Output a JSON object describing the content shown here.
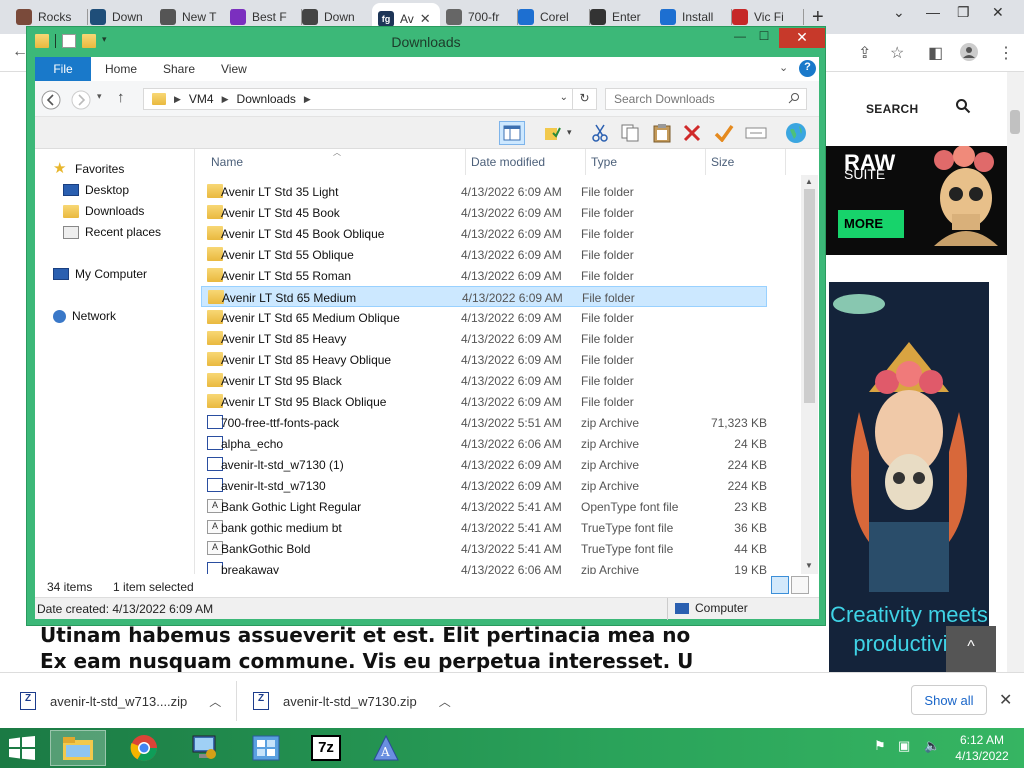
{
  "browser": {
    "tabs": [
      {
        "label": "Rocks",
        "icon": "avatar-icon",
        "color": "#7a4a3a"
      },
      {
        "label": "Down",
        "icon": "download-site-icon",
        "color": "#1f4e79"
      },
      {
        "label": "New T",
        "icon": "chrome-icon",
        "color": "#555555"
      },
      {
        "label": "Best F",
        "icon": "purple-site-icon",
        "color": "#7b2fbf"
      },
      {
        "label": "Down",
        "icon": "download-icon",
        "color": "#444444"
      },
      {
        "label": "Av",
        "icon": "fg-icon",
        "color": "#1d3557",
        "active": true
      },
      {
        "label": "700-fr",
        "icon": "globe-icon",
        "color": "#666666"
      },
      {
        "label": "Corel",
        "icon": "blue-dot-icon",
        "color": "#1d6fd1"
      },
      {
        "label": "Enter",
        "icon": "x-site-icon",
        "color": "#333333"
      },
      {
        "label": "Install",
        "icon": "blue-dot-icon",
        "color": "#1d6fd1"
      },
      {
        "label": "Vic Fi",
        "icon": "red-site-icon",
        "color": "#c62828"
      }
    ],
    "active_tab_favicon_text": "fg",
    "newtab_label": "+"
  },
  "website": {
    "search_label": "SEARCH",
    "ad1_title": "RAW",
    "ad1_subtitle": "SUITE",
    "ad1_button": "MORE",
    "ad2_text": "Creativity meets productivity",
    "lorem_line1": "Utinam habemus assueverit et est. Elit pertinacia mea no",
    "lorem_line2": "Ex eam nusquam commune. Vis eu perpetua interesset. U",
    "scrolltop_label": "^"
  },
  "downloads_bar": {
    "items": [
      {
        "label": "avenir-lt-std_w713....zip"
      },
      {
        "label": "avenir-lt-std_w7130.zip"
      }
    ],
    "show_all": "Show all"
  },
  "explorer": {
    "title": "Downloads",
    "ribbon_tabs": [
      "File",
      "Home",
      "Share",
      "View"
    ],
    "address": {
      "root": "VM4",
      "folder": "Downloads"
    },
    "search_placeholder": "Search Downloads",
    "nav": {
      "favorites": "Favorites",
      "desktop": "Desktop",
      "downloads": "Downloads",
      "recent": "Recent places",
      "computer": "My Computer",
      "network": "Network"
    },
    "columns": {
      "name": "Name",
      "date": "Date modified",
      "type": "Type",
      "size": "Size"
    },
    "files": [
      {
        "name": "Avenir LT Std 35 Light",
        "date": "4/13/2022 6:09 AM",
        "type": "File folder",
        "size": "",
        "kind": "folder"
      },
      {
        "name": "Avenir LT Std 45 Book",
        "date": "4/13/2022 6:09 AM",
        "type": "File folder",
        "size": "",
        "kind": "folder"
      },
      {
        "name": "Avenir LT Std 45 Book Oblique",
        "date": "4/13/2022 6:09 AM",
        "type": "File folder",
        "size": "",
        "kind": "folder"
      },
      {
        "name": "Avenir LT Std 55 Oblique",
        "date": "4/13/2022 6:09 AM",
        "type": "File folder",
        "size": "",
        "kind": "folder"
      },
      {
        "name": "Avenir LT Std 55 Roman",
        "date": "4/13/2022 6:09 AM",
        "type": "File folder",
        "size": "",
        "kind": "folder"
      },
      {
        "name": "Avenir LT Std 65 Medium",
        "date": "4/13/2022 6:09 AM",
        "type": "File folder",
        "size": "",
        "kind": "folder",
        "selected": true
      },
      {
        "name": "Avenir LT Std 65 Medium Oblique",
        "date": "4/13/2022 6:09 AM",
        "type": "File folder",
        "size": "",
        "kind": "folder"
      },
      {
        "name": "Avenir LT Std 85 Heavy",
        "date": "4/13/2022 6:09 AM",
        "type": "File folder",
        "size": "",
        "kind": "folder"
      },
      {
        "name": "Avenir LT Std 85 Heavy Oblique",
        "date": "4/13/2022 6:09 AM",
        "type": "File folder",
        "size": "",
        "kind": "folder"
      },
      {
        "name": "Avenir LT Std 95 Black",
        "date": "4/13/2022 6:09 AM",
        "type": "File folder",
        "size": "",
        "kind": "folder"
      },
      {
        "name": "Avenir LT Std 95 Black Oblique",
        "date": "4/13/2022 6:09 AM",
        "type": "File folder",
        "size": "",
        "kind": "folder"
      },
      {
        "name": "700-free-ttf-fonts-pack",
        "date": "4/13/2022 5:51 AM",
        "type": "zip Archive",
        "size": "71,323 KB",
        "kind": "zip"
      },
      {
        "name": "alpha_echo",
        "date": "4/13/2022 6:06 AM",
        "type": "zip Archive",
        "size": "24 KB",
        "kind": "zip"
      },
      {
        "name": "avenir-lt-std_w7130 (1)",
        "date": "4/13/2022 6:09 AM",
        "type": "zip Archive",
        "size": "224 KB",
        "kind": "zip"
      },
      {
        "name": "avenir-lt-std_w7130",
        "date": "4/13/2022 6:09 AM",
        "type": "zip Archive",
        "size": "224 KB",
        "kind": "zip"
      },
      {
        "name": "Bank Gothic Light Regular",
        "date": "4/13/2022 5:41 AM",
        "type": "OpenType font file",
        "size": "23 KB",
        "kind": "font"
      },
      {
        "name": "bank gothic medium bt",
        "date": "4/13/2022 5:41 AM",
        "type": "TrueType font file",
        "size": "36 KB",
        "kind": "font"
      },
      {
        "name": "BankGothic Bold",
        "date": "4/13/2022 5:41 AM",
        "type": "TrueType font file",
        "size": "44 KB",
        "kind": "font"
      },
      {
        "name": "breakaway",
        "date": "4/13/2022 6:06 AM",
        "type": "zip Archive",
        "size": "19 KB",
        "kind": "zip"
      }
    ],
    "status": {
      "count": "34 items",
      "selected": "1 item selected"
    },
    "details": {
      "date_created": "Date created: 4/13/2022 6:09 AM",
      "location": "Computer"
    }
  },
  "taskbar": {
    "time": "6:12 AM",
    "date": "4/13/2022",
    "apps": [
      "file-explorer-icon",
      "chrome-icon",
      "computer-settings-icon",
      "control-panel-icon",
      "7zip-icon",
      "font-app-icon"
    ],
    "sevenzip_label": "7z"
  },
  "colors": {
    "explorer_frame": "#3cb878",
    "taskbar": "#2aa35a",
    "selection": "#cce8ff",
    "file_tab": "#1979ca"
  }
}
